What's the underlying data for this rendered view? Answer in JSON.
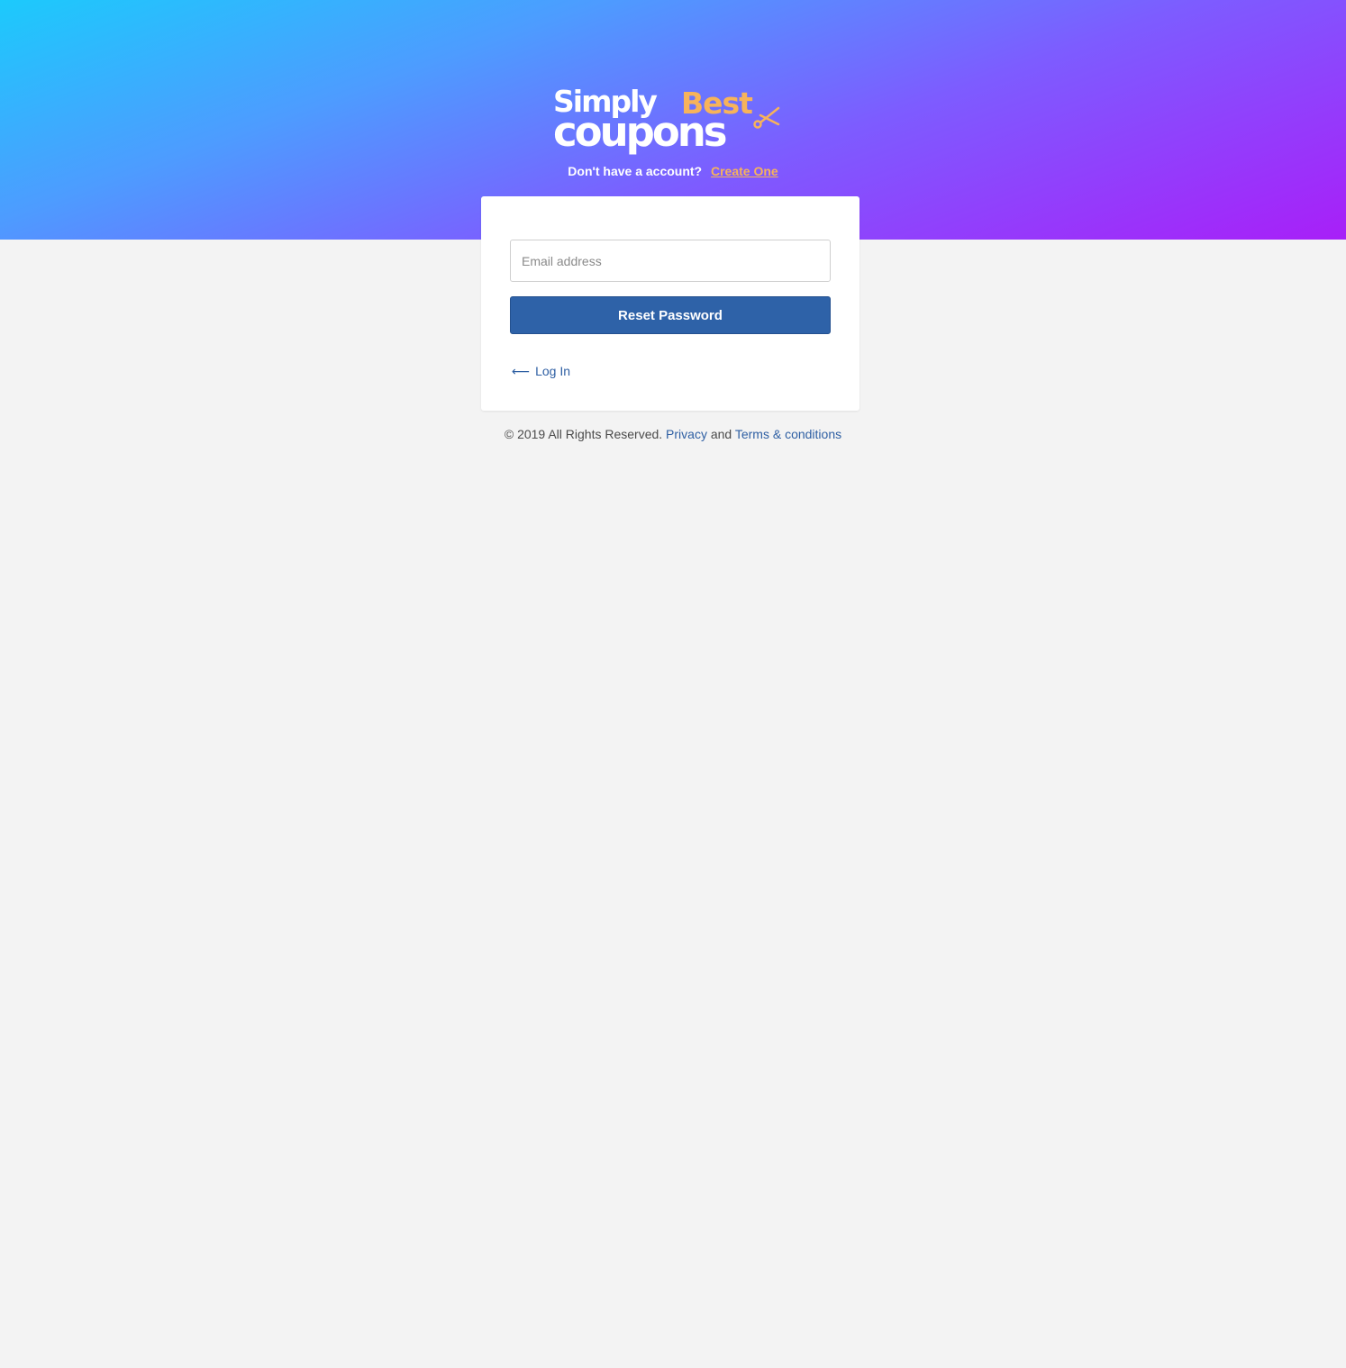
{
  "brand": {
    "logo_word1": "Simply",
    "logo_word2": "Best",
    "logo_word3": "coupons",
    "logo_primary_color": "#ffffff",
    "logo_accent_color": "#f7b35a"
  },
  "signup": {
    "question": "Don't have a account?",
    "link_label": "Create One"
  },
  "form": {
    "email_placeholder": "Email address",
    "email_value": "",
    "submit_label": "Reset Password",
    "back_link_label": "Log In",
    "back_icon": "arrow-left-icon"
  },
  "footer": {
    "copyright": "© 2019 All Rights Reserved.",
    "privacy_label": "Privacy",
    "and_text": "and",
    "terms_label": "Terms & conditions"
  },
  "colors": {
    "hero_gradient_start": "#1ccafc",
    "hero_gradient_end": "#a81ff8",
    "primary_button": "#2e62a8",
    "link": "#2e5fa3",
    "page_background": "#f3f3f3"
  }
}
